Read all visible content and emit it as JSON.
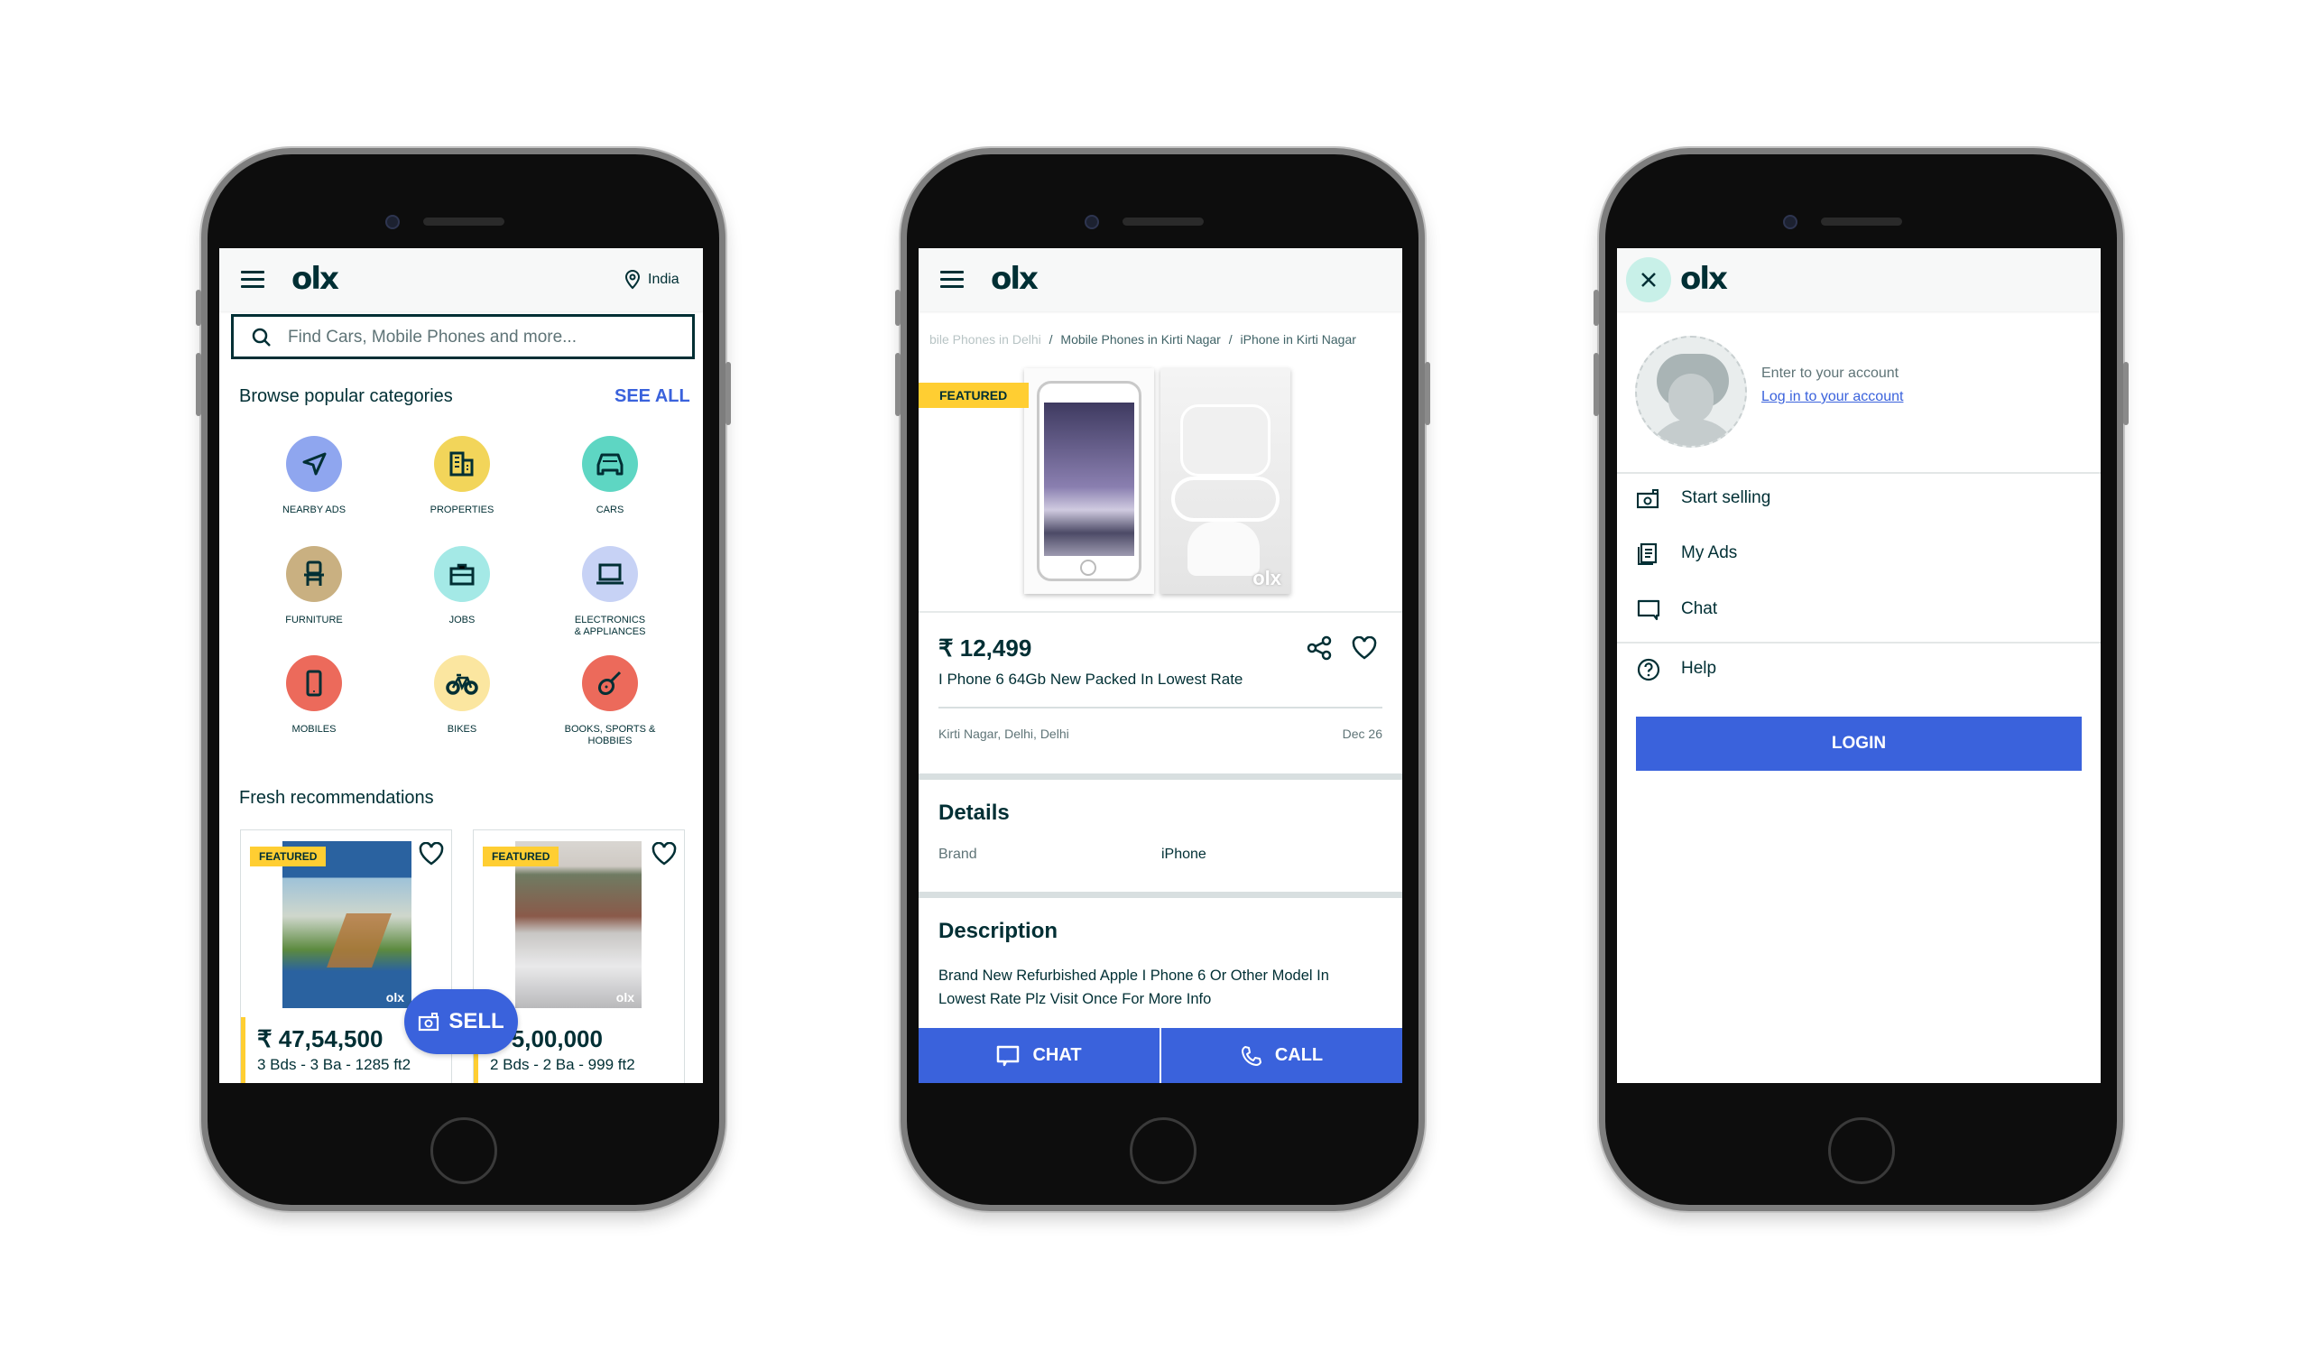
{
  "brand": {
    "logo_text": "olx",
    "accent": "#3a62dc",
    "featured_color": "#ffce32",
    "text_color": "#002f34"
  },
  "home_screen": {
    "location": "India",
    "search": {
      "placeholder": "Find Cars, Mobile Phones and more..."
    },
    "categories_title": "Browse popular categories",
    "see_all": "SEE ALL",
    "categories": [
      {
        "label": "NEARBY ADS",
        "icon": "navigation-arrow-icon",
        "color": "#8fa6ef"
      },
      {
        "label": "PROPERTIES",
        "icon": "building-icon",
        "color": "#f2d55a"
      },
      {
        "label": "CARS",
        "icon": "car-icon",
        "color": "#5ed6c3"
      },
      {
        "label": "FURNITURE",
        "icon": "chair-icon",
        "color": "#c9b081"
      },
      {
        "label": "JOBS",
        "icon": "briefcase-icon",
        "color": "#a4e9e6"
      },
      {
        "label": "ELECTRONICS & APPLIANCES",
        "icon": "laptop-icon",
        "color": "#c7d2f5"
      },
      {
        "label": "MOBILES",
        "icon": "mobile-phone-icon",
        "color": "#ec6a5b"
      },
      {
        "label": "BIKES",
        "icon": "bicycle-icon",
        "color": "#fbe6a0"
      },
      {
        "label": "BOOKS, SPORTS & HOBBIES",
        "icon": "guitar-icon",
        "color": "#ec6a5b"
      }
    ],
    "recommendations_title": "Fresh recommendations",
    "listings": [
      {
        "badge": "FEATURED",
        "price": "₹ 47,54,500",
        "specs": "3 Bds - 3 Ba - 1285 ft2"
      },
      {
        "badge": "FEATURED",
        "price": "₹ 5,00,000",
        "specs": "2 Bds - 2 Ba - 999 ft2"
      }
    ],
    "sell_button": "SELL"
  },
  "detail_screen": {
    "breadcrumb": [
      "bile Phones in Delhi",
      "Mobile Phones in Kirti Nagar",
      "iPhone in Kirti Nagar"
    ],
    "breadcrumb_sep": "/",
    "badge": "FEATURED",
    "price": "₹ 12,499",
    "title": "I Phone 6 64Gb New Packed In Lowest Rate",
    "location": "Kirti Nagar, Delhi, Delhi",
    "date": "Dec 26",
    "details_title": "Details",
    "details": [
      {
        "key": "Brand",
        "value": "iPhone"
      }
    ],
    "description_title": "Description",
    "description": "Brand New Refurbished Apple I Phone 6 Or Other Model In Lowest Rate Plz Visit Once For More Info",
    "chat_button": "CHAT",
    "call_button": "CALL"
  },
  "menu_screen": {
    "account_prompt": "Enter to your account",
    "login_link": "Log in to your account",
    "items": [
      {
        "label": "Start selling",
        "icon": "camera-icon"
      },
      {
        "label": "My Ads",
        "icon": "ads-list-icon"
      },
      {
        "label": "Chat",
        "icon": "chat-icon"
      },
      {
        "label": "Help",
        "icon": "help-icon"
      }
    ],
    "login_button": "LOGIN"
  }
}
